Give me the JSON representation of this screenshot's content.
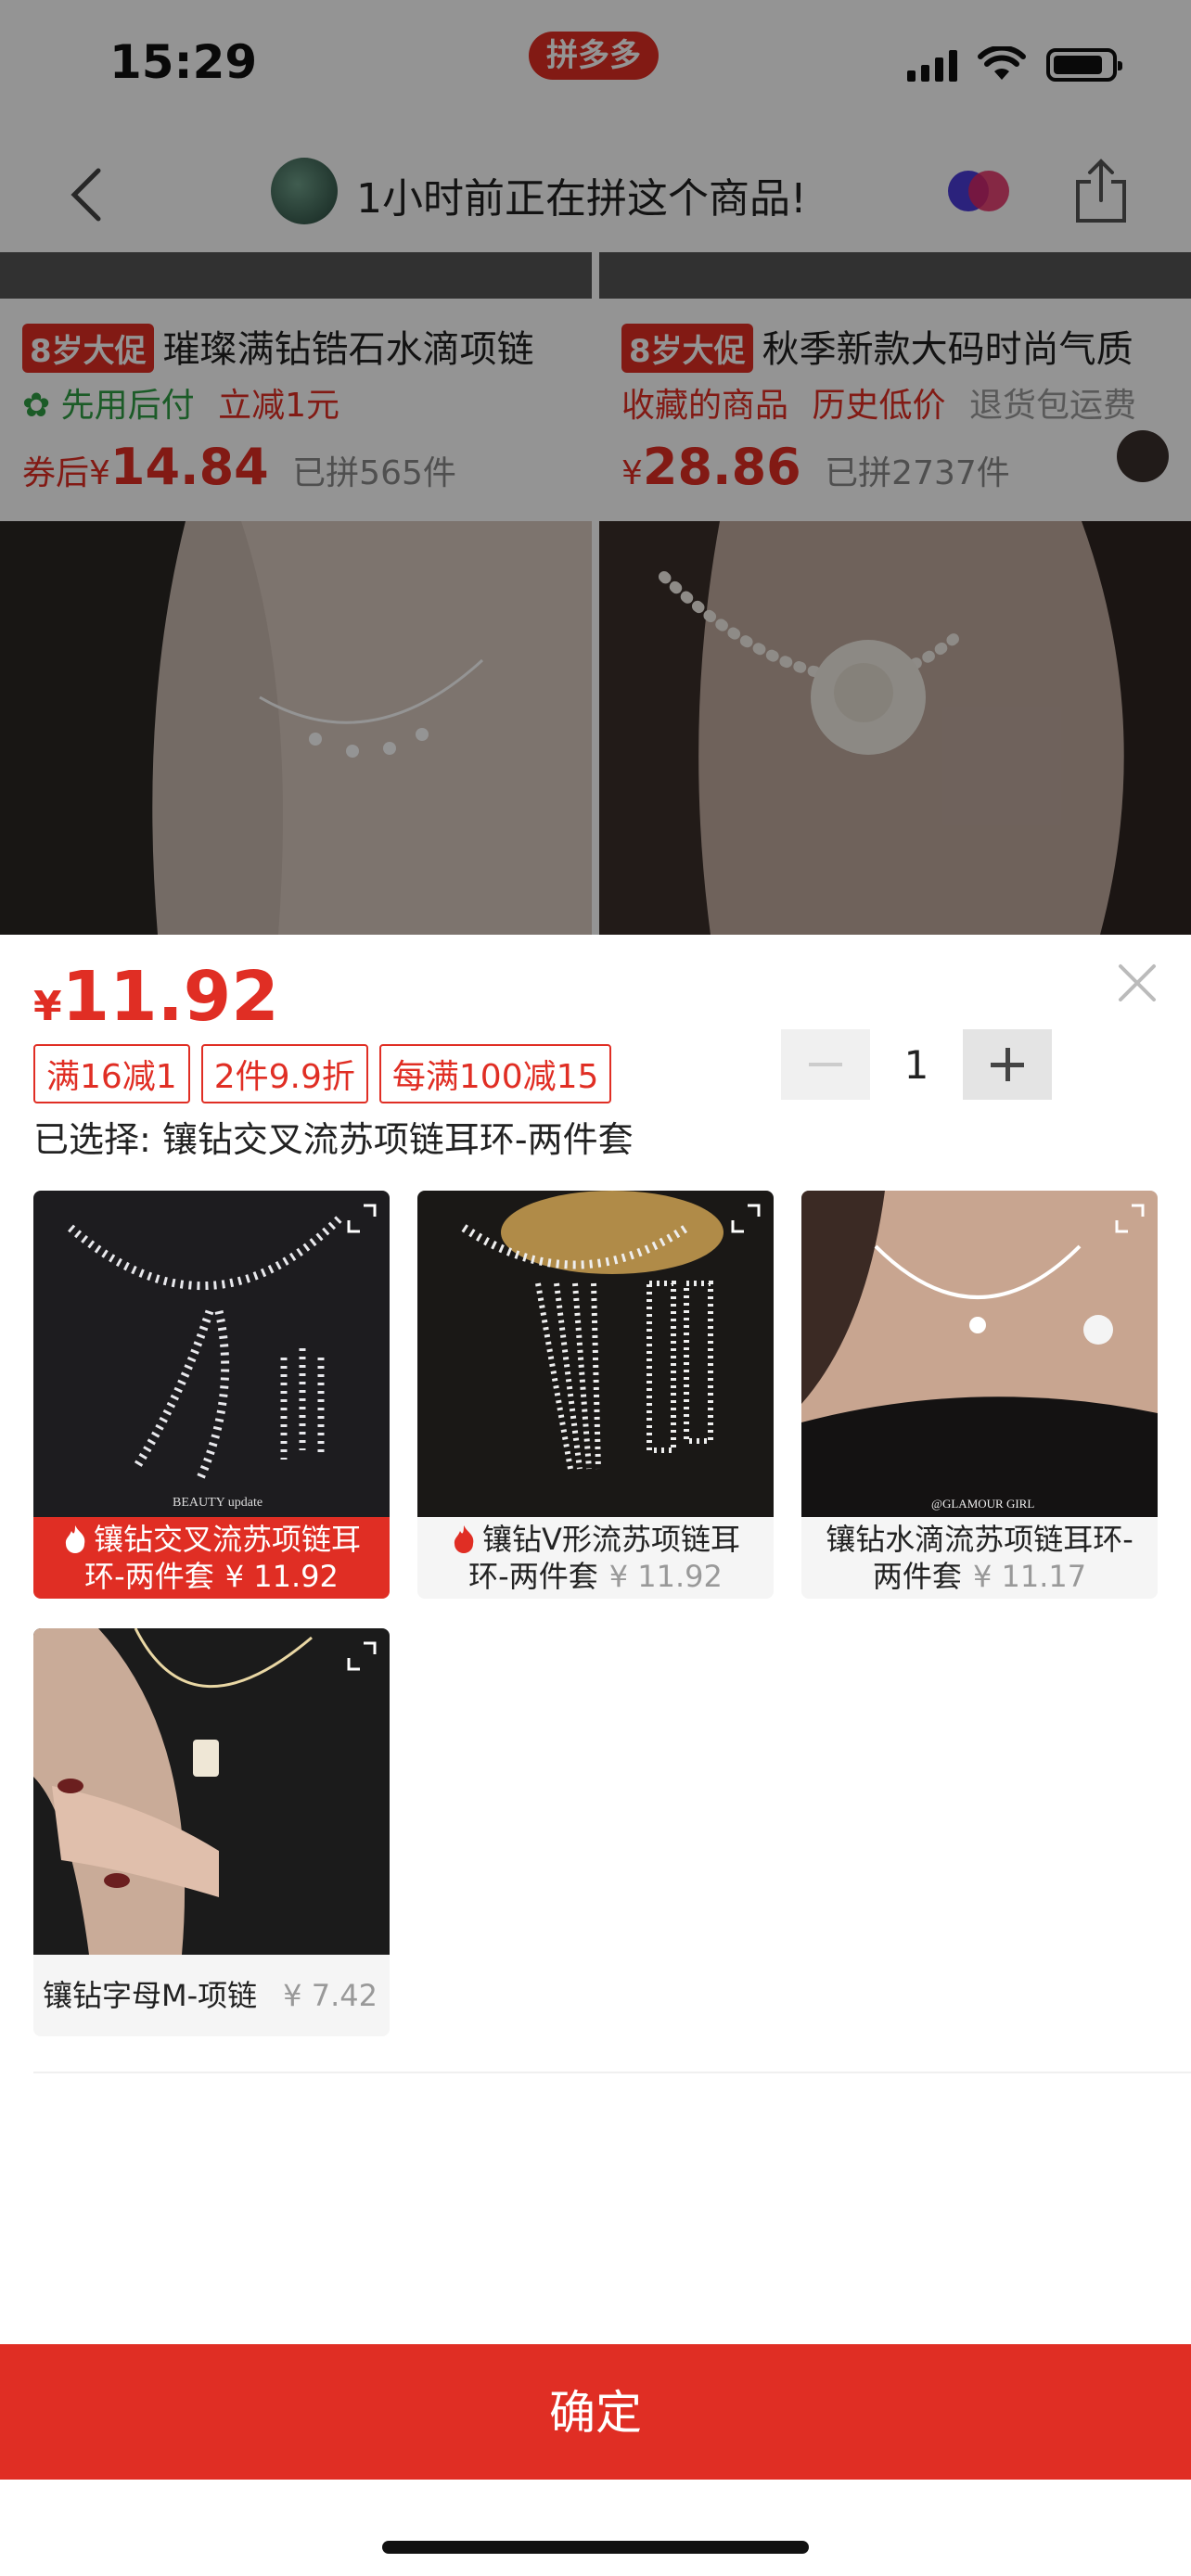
{
  "status": {
    "time": "15:29",
    "app_badge": "拼多多"
  },
  "nav": {
    "title": "1小时前正在拼这个商品!"
  },
  "feed": [
    {
      "promo": "8岁大促",
      "title": "璀璨满钻锆石水滴项链",
      "sub_a": "先用后付",
      "sub_b": "立减1元",
      "price_prefix": "券后¥",
      "price": "14.84",
      "sold": "已拼565件"
    },
    {
      "promo": "8岁大促",
      "title": "秋季新款大码时尚气质",
      "sub_a": "收藏的商品",
      "sub_b": "历史低价",
      "sub_c": "退货包运费",
      "price_prefix": "¥",
      "price": "28.86",
      "sold": "已拼2737件"
    }
  ],
  "sheet": {
    "price_symbol": "¥",
    "price": "11.92",
    "coupons": [
      "满16减1",
      "2件9.9折",
      "每满100减15"
    ],
    "quantity": "1",
    "selected_text": "已选择: 镶钻交叉流苏项链耳环-两件套",
    "variants": [
      {
        "label_line1": "镶钻交叉流苏项链耳",
        "label_line2": "环-两件套",
        "price": "¥ 11.92",
        "selected": true,
        "hot": true
      },
      {
        "label_line1": "镶钻V形流苏项链耳",
        "label_line2": "环-两件套",
        "price": "¥ 11.92",
        "selected": false,
        "hot": true
      },
      {
        "label_line1": "镶钻水滴流苏项链耳环-",
        "label_line2": "两件套",
        "price": "¥ 11.17",
        "selected": false,
        "hot": false
      },
      {
        "label_line1": "镶钻字母M-项链",
        "price": "¥ 7.42",
        "selected": false,
        "hot": false
      }
    ],
    "image_captions": [
      "BEAUTY update",
      "@GLAMOUR GIRL"
    ],
    "confirm_label": "确定"
  },
  "colors": {
    "accent": "#e02e24",
    "green": "#2f9e44"
  }
}
